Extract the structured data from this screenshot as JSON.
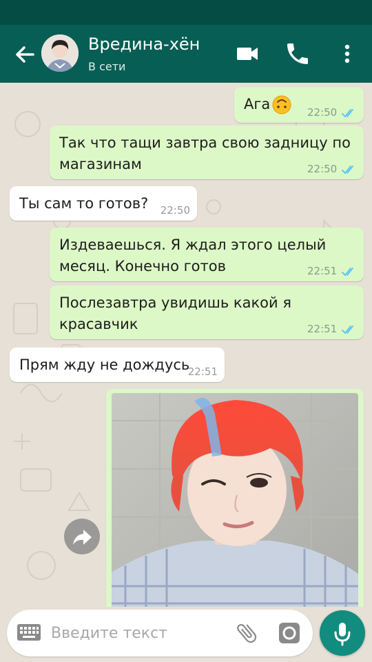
{
  "header": {
    "contact_name": "Вредина-хён",
    "contact_status": "В сети",
    "icons": [
      "back-arrow-icon",
      "video-call-icon",
      "phone-icon",
      "more-vertical-icon"
    ]
  },
  "messages": [
    {
      "direction": "out",
      "text": "Ага",
      "emoji": "upside-down-face",
      "time": "22:50",
      "status": "read"
    },
    {
      "direction": "out",
      "text_lines": [
        "Так что тащи завтра свою задницу по",
        "магазинам"
      ],
      "time": "22:50",
      "status": "read"
    },
    {
      "direction": "in",
      "text": "Ты сам то готов?",
      "time": "22:50"
    },
    {
      "direction": "out",
      "text_lines": [
        "Издеваешься. Я ждал этого целый",
        "месяц. Конечно готов"
      ],
      "time": "22:51",
      "status": "read"
    },
    {
      "direction": "out",
      "text_lines": [
        "Послезавтра увидишь какой я",
        "красавчик"
      ],
      "time": "22:51",
      "status": "read"
    },
    {
      "direction": "in",
      "text": "Прям жду не дождусь",
      "time": "22:51"
    },
    {
      "direction": "out",
      "type": "photo",
      "description": "selfie of a winking person with red hair and a blue checked shirt"
    }
  ],
  "input": {
    "placeholder": "Введите текст",
    "icons": [
      "keyboard-icon",
      "attach-icon",
      "camera-icon",
      "mic-icon"
    ]
  },
  "colors": {
    "header": "#075e54",
    "status_bar": "#054d44",
    "outgoing_bubble": "#dcf8c6",
    "incoming_bubble": "#ffffff",
    "read_ticks": "#4fc3f7",
    "mic_button": "#128c7e",
    "chat_background": "#e6e0d6"
  }
}
